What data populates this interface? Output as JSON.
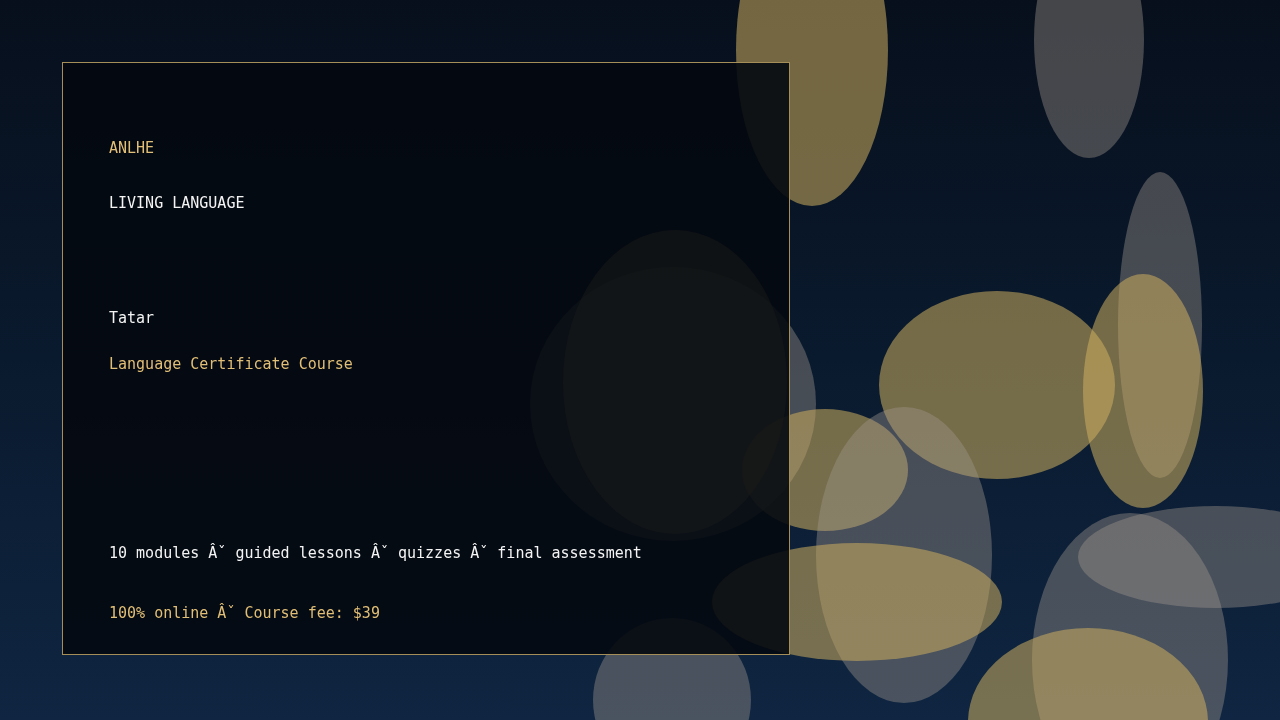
{
  "card": {
    "brand": "ANLHE",
    "tagline": "LIVING LANGUAGE",
    "language": "Tatar",
    "course_type": "Language Certificate Course",
    "features": "10 modules Âˇ guided lessons Âˇ quizzes Âˇ final assessment",
    "pricing": "100% online Âˇ Course fee: $39"
  }
}
